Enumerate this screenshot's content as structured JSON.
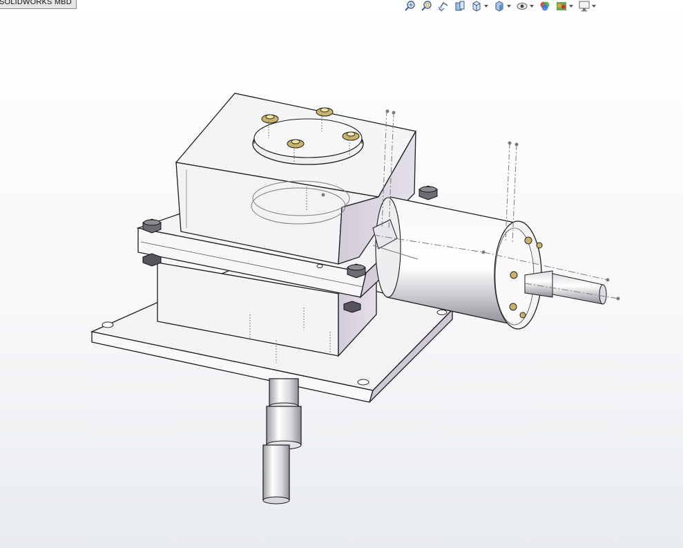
{
  "app": {
    "tab_label": "SOLIDWORKS MBD"
  },
  "heads_up_toolbar": {
    "items": [
      {
        "icon": "zoom-to-fit-icon"
      },
      {
        "icon": "zoom-to-area-icon"
      },
      {
        "icon": "previous-view-icon"
      },
      {
        "icon": "section-view-icon"
      },
      {
        "icon": "view-orientation-icon",
        "dropdown": true
      },
      {
        "icon": "display-style-icon",
        "dropdown": true
      },
      {
        "icon": "hide-show-items-icon",
        "dropdown": true
      },
      {
        "icon": "edit-appearance-icon"
      },
      {
        "icon": "apply-scene-icon",
        "dropdown": true
      },
      {
        "icon": "view-settings-icon",
        "dropdown": true
      }
    ]
  },
  "colors": {
    "part_face": "#f2f2f4",
    "part_shadow": "#c9c9cf",
    "part_edge": "#1a1a1a",
    "bolt_brass": "#c9b36a",
    "sketch_line": "#7a7a7a",
    "background_top": "#ffffff",
    "background_bottom": "#e9ecef"
  }
}
